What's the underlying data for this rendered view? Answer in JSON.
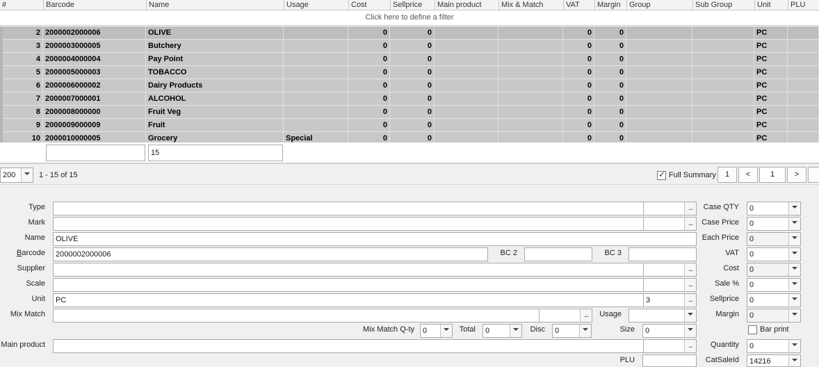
{
  "grid": {
    "columns": [
      "#",
      "Barcode",
      "Name",
      "Usage",
      "Cost",
      "Sellprice",
      "Main product",
      "Mix & Match",
      "VAT",
      "Margin",
      "Group",
      "Sub Group",
      "Unit",
      "PLU"
    ],
    "filter_hint": "Click here to define a filter",
    "rows": [
      {
        "num": "2",
        "barcode": "2000002000006",
        "name": "OLIVE",
        "usage": "",
        "cost": "0",
        "sellprice": "0",
        "vat": "0",
        "margin": "0",
        "unit": "PC"
      },
      {
        "num": "3",
        "barcode": "2000003000005",
        "name": "Butchery",
        "usage": "",
        "cost": "0",
        "sellprice": "0",
        "vat": "0",
        "margin": "0",
        "unit": "PC"
      },
      {
        "num": "4",
        "barcode": "2000004000004",
        "name": "Pay Point",
        "usage": "",
        "cost": "0",
        "sellprice": "0",
        "vat": "0",
        "margin": "0",
        "unit": "PC"
      },
      {
        "num": "5",
        "barcode": "2000005000003",
        "name": "TOBACCO",
        "usage": "",
        "cost": "0",
        "sellprice": "0",
        "vat": "0",
        "margin": "0",
        "unit": "PC"
      },
      {
        "num": "6",
        "barcode": "2000006000002",
        "name": "Dairy Products",
        "usage": "",
        "cost": "0",
        "sellprice": "0",
        "vat": "0",
        "margin": "0",
        "unit": "PC"
      },
      {
        "num": "7",
        "barcode": "2000007000001",
        "name": "ALCOHOL",
        "usage": "",
        "cost": "0",
        "sellprice": "0",
        "vat": "0",
        "margin": "0",
        "unit": "PC"
      },
      {
        "num": "8",
        "barcode": "2000008000000",
        "name": "Fruit Veg",
        "usage": "",
        "cost": "0",
        "sellprice": "0",
        "vat": "0",
        "margin": "0",
        "unit": "PC"
      },
      {
        "num": "9",
        "barcode": "2000009000009",
        "name": "Fruit",
        "usage": "",
        "cost": "0",
        "sellprice": "0",
        "vat": "0",
        "margin": "0",
        "unit": "PC"
      },
      {
        "num": "10",
        "barcode": "2000010000005",
        "name": "Grocery",
        "usage": "Special",
        "cost": "0",
        "sellprice": "0",
        "vat": "0",
        "margin": "0",
        "unit": "PC"
      }
    ],
    "footer_barcode": "",
    "footer_name": "15"
  },
  "pager": {
    "page_size": "200",
    "range_text": "1 - 15 of 15",
    "full_summary_label": "Full Summary",
    "full_summary_checked": true,
    "first": "1",
    "prev": "<",
    "current": "1",
    "next": ">"
  },
  "form": {
    "type_label": "Type",
    "type_value": "",
    "mark_label": "Mark",
    "mark_value": "",
    "name_label": "Name",
    "name_value": "OLIVE",
    "barcode_label_pre": "B",
    "barcode_label_post": "arcode",
    "barcode_value": "2000002000006",
    "bc2_label": "BC 2",
    "bc2_value": "",
    "bc3_label": "BC 3",
    "bc3_value": "",
    "supplier_label": "Supplier",
    "supplier_value": "",
    "scale_label": "Scale",
    "scale_value": "",
    "unit_label": "Unit",
    "unit_value": "PC",
    "unit_qty": "3",
    "mixmatch_label": "Mix Match",
    "mixmatch_value": "",
    "usage_label": "Usage",
    "usage_value": "",
    "mmqty_label": "Mix Match Q-ty",
    "mmqty_value": "0",
    "total_label": "Total",
    "total_value": "0",
    "disc_label": "Disc",
    "disc_value": "0",
    "size_label": "Size",
    "size_value": "0",
    "mainproduct_label": "Main product",
    "mainproduct_value": "",
    "plu_label": "PLU",
    "plu_value": "",
    "ellipsis": "...",
    "right": {
      "case_qty_label": "Case QTY",
      "case_qty_value": "0",
      "case_price_label": "Case Price",
      "case_price_value": "0",
      "each_price_label": "Each Price",
      "each_price_value": "0",
      "vat_label": "VAT",
      "vat_value": "0",
      "cost_label": "Cost",
      "cost_value": "0",
      "sale_label": "Sale %",
      "sale_value": "0",
      "sellprice_label": "Sellprice",
      "sellprice_value": "0",
      "margin_label": "Margin",
      "margin_value": "0",
      "bar_print_label": "Bar print",
      "quantity_label": "Quantity",
      "quantity_value": "0",
      "catsaleid_label": "CatSaleId",
      "catsaleid_value": "14216"
    }
  }
}
